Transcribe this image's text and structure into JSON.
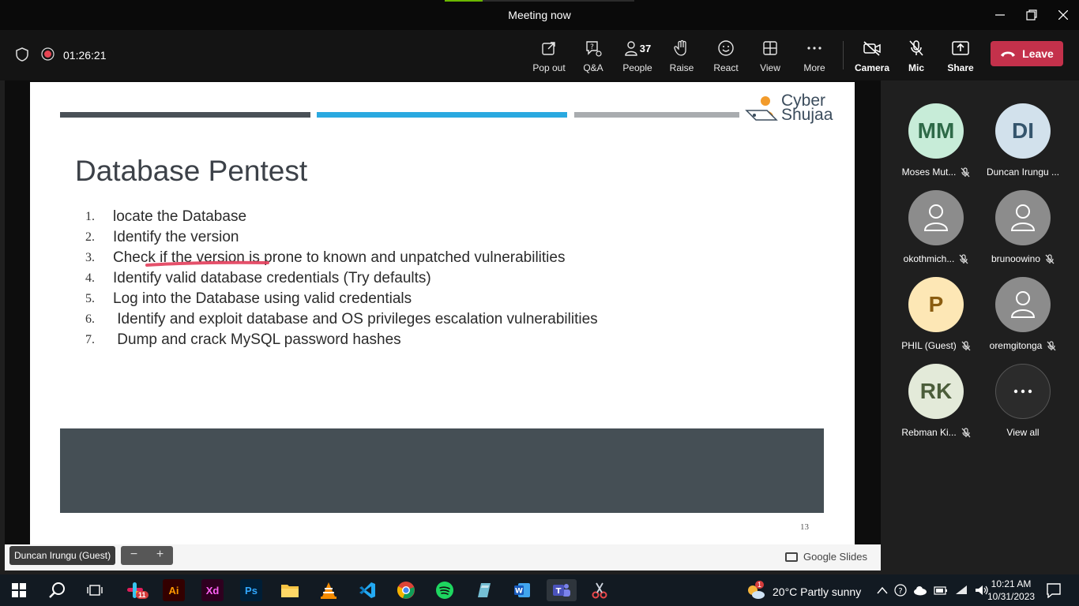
{
  "window": {
    "title": "Meeting now"
  },
  "meeting": {
    "timer": "01:26:21",
    "toolbar": {
      "popout": "Pop out",
      "qa": "Q&A",
      "people": "People",
      "people_count": "37",
      "raise": "Raise",
      "react": "React",
      "view": "View",
      "more": "More",
      "camera": "Camera",
      "mic": "Mic",
      "share": "Share",
      "leave": "Leave"
    }
  },
  "slide": {
    "logo_line1": "Cyber",
    "logo_line2": "Shujaa",
    "title": "Database Pentest",
    "items": [
      {
        "num": "1.",
        "text": "locate the Database"
      },
      {
        "num": "2.",
        "text": "Identify the version"
      },
      {
        "num": "3.",
        "text": "Check if the version is prone to known and unpatched vulnerabilities"
      },
      {
        "num": "4.",
        "text": "Identify valid database credentials (Try defaults)"
      },
      {
        "num": "5.",
        "text": "Log into the Database using valid credentials"
      },
      {
        "num": "6.",
        "text": " Identify and exploit database and OS privileges escalation vulnerabilities"
      },
      {
        "num": "7.",
        "text": " Dump and crack MySQL password hashes"
      }
    ],
    "page_number": "13",
    "bar_colors": [
      "#4a5157",
      "#2aa9e0",
      "#a9acaf"
    ],
    "footer_color": "#454f55"
  },
  "presenter": {
    "name": "Duncan Irungu (Guest)"
  },
  "zoom": {
    "minus": "−",
    "plus": "+"
  },
  "source": {
    "label": "Google Slides"
  },
  "participants": [
    {
      "initials": "MM",
      "name": "Moses Mut...",
      "avatar_bg": "#c7ecd8",
      "avatar_fg": "#2e6a48",
      "muted": true,
      "icon": "initials"
    },
    {
      "initials": "DI",
      "name": "Duncan Irungu ...",
      "avatar_bg": "#d2e1ec",
      "avatar_fg": "#35556d",
      "muted": false,
      "icon": "initials"
    },
    {
      "initials": "",
      "name": "okothmich...",
      "avatar_bg": "#8c8c8c",
      "avatar_fg": "#ffffff",
      "muted": true,
      "icon": "person"
    },
    {
      "initials": "",
      "name": "brunoowino",
      "avatar_bg": "#8c8c8c",
      "avatar_fg": "#ffffff",
      "muted": true,
      "icon": "person"
    },
    {
      "initials": "P",
      "name": "PHIL (Guest)",
      "avatar_bg": "#fde7b5",
      "avatar_fg": "#8a5c10",
      "muted": true,
      "icon": "initials"
    },
    {
      "initials": "",
      "name": "oremgitonga",
      "avatar_bg": "#8c8c8c",
      "avatar_fg": "#ffffff",
      "muted": true,
      "icon": "person"
    },
    {
      "initials": "RK",
      "name": "Rebman Ki...",
      "avatar_bg": "#e3ead9",
      "avatar_fg": "#4b5d3a",
      "muted": true,
      "icon": "initials"
    },
    {
      "initials": "",
      "name": "View all",
      "avatar_bg": "#2b2b2b",
      "avatar_fg": "#ffffff",
      "muted": false,
      "icon": "more"
    }
  ],
  "taskbar": {
    "slack_badge": "11",
    "weather_badge": "1",
    "weather": "20°C  Partly sunny",
    "time": "10:21 AM",
    "date": "10/31/2023",
    "apps": [
      "windows-start",
      "search",
      "task-view",
      "slack",
      "illustrator",
      "xd",
      "photoshop",
      "file-explorer",
      "vlc",
      "vscode",
      "chrome",
      "spotify",
      "app-glass",
      "word",
      "teams",
      "snipping-tool"
    ]
  },
  "colors": {
    "accent_red": "#c4314b",
    "progress_green": "#6bb700"
  }
}
